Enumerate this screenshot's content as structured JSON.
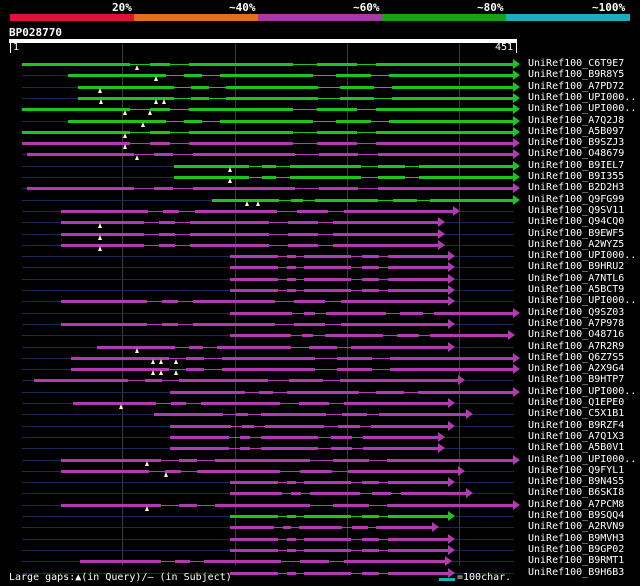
{
  "header": {
    "percent_labels": [
      "20%",
      "~40%",
      "~60%",
      "~80%",
      "~100%"
    ],
    "query_id": "BP028770",
    "query_start": "1",
    "query_end": "451"
  },
  "colors": {
    "scale": [
      "#e0103a",
      "#e0701e",
      "#a83aa8",
      "#18a018",
      "#18b0c0"
    ],
    "green": "#1ec41e",
    "purple": "#b03ab0",
    "background_line": "#1b2a55",
    "gap_marker": "#fff8c0"
  },
  "hits": [
    {
      "label": "UniRef100_C6T9E7",
      "start": 1,
      "end": 451,
      "color": "green",
      "gaps": [
        106
      ]
    },
    {
      "label": "UniRef100_B9R8Y5",
      "start": 43,
      "end": 451,
      "color": "green",
      "gaps": [
        124
      ]
    },
    {
      "label": "UniRef100_A7PD72",
      "start": 52,
      "end": 451,
      "color": "green",
      "gaps": [
        72
      ]
    },
    {
      "label": "UniRef100_UPI000..",
      "start": 52,
      "end": 451,
      "color": "green",
      "gaps": [
        73,
        124,
        131
      ]
    },
    {
      "label": "UniRef100_UPI000..",
      "start": 1,
      "end": 451,
      "color": "green",
      "gaps": [
        95,
        118
      ]
    },
    {
      "label": "UniRef100_A7Q2J8",
      "start": 43,
      "end": 451,
      "color": "green",
      "gaps": [
        112
      ]
    },
    {
      "label": "UniRef100_A5B097",
      "start": 1,
      "end": 451,
      "color": "green",
      "gaps": [
        95
      ]
    },
    {
      "label": "UniRef100_B9SZJ3",
      "start": 1,
      "end": 451,
      "color": "purple",
      "gaps": [
        95
      ]
    },
    {
      "label": "UniRef100_O48679",
      "start": 6,
      "end": 451,
      "color": "purple",
      "gaps": [
        106
      ]
    },
    {
      "label": "UniRef100_B9IEL7",
      "start": 140,
      "end": 451,
      "color": "green",
      "gaps": [
        191
      ]
    },
    {
      "label": "UniRef100_B9I355",
      "start": 140,
      "end": 451,
      "color": "green",
      "gaps": [
        191
      ]
    },
    {
      "label": "UniRef100_B2D2H3",
      "start": 6,
      "end": 451,
      "color": "purple",
      "gaps": []
    },
    {
      "label": "UniRef100_Q9FG99",
      "start": 175,
      "end": 451,
      "color": "green",
      "gaps": [
        207,
        217
      ]
    },
    {
      "label": "UniRef100_Q9SV11",
      "start": 37,
      "end": 396,
      "color": "purple",
      "gaps": []
    },
    {
      "label": "UniRef100_Q94CQ0",
      "start": 37,
      "end": 382,
      "color": "purple",
      "gaps": [
        72
      ]
    },
    {
      "label": "UniRef100_B9EWF5",
      "start": 37,
      "end": 382,
      "color": "purple",
      "gaps": [
        72
      ]
    },
    {
      "label": "UniRef100_A2WYZ5",
      "start": 37,
      "end": 382,
      "color": "purple",
      "gaps": [
        72
      ]
    },
    {
      "label": "UniRef100_UPI000..",
      "start": 191,
      "end": 392,
      "color": "purple",
      "gaps": []
    },
    {
      "label": "UniRef100_B9HRU2",
      "start": 191,
      "end": 392,
      "color": "purple",
      "gaps": []
    },
    {
      "label": "UniRef100_A7NTL6",
      "start": 191,
      "end": 392,
      "color": "purple",
      "gaps": []
    },
    {
      "label": "UniRef100_A5BCT9",
      "start": 191,
      "end": 392,
      "color": "purple",
      "gaps": []
    },
    {
      "label": "UniRef100_UPI000..",
      "start": 37,
      "end": 392,
      "color": "purple",
      "gaps": []
    },
    {
      "label": "UniRef100_Q9SZ03",
      "start": 191,
      "end": 451,
      "color": "purple",
      "gaps": []
    },
    {
      "label": "UniRef100_A7P978",
      "start": 37,
      "end": 392,
      "color": "purple",
      "gaps": []
    },
    {
      "label": "UniRef100_O48716",
      "start": 191,
      "end": 446,
      "color": "purple",
      "gaps": []
    },
    {
      "label": "UniRef100_A7R2R9",
      "start": 70,
      "end": 392,
      "color": "purple",
      "gaps": [
        106
      ]
    },
    {
      "label": "UniRef100_Q6Z7S5",
      "start": 46,
      "end": 451,
      "color": "purple",
      "gaps": [
        121,
        128,
        142
      ]
    },
    {
      "label": "UniRef100_A2X9G4",
      "start": 46,
      "end": 451,
      "color": "purple",
      "gaps": [
        121,
        128,
        142
      ]
    },
    {
      "label": "UniRef100_B9HTP7",
      "start": 12,
      "end": 401,
      "color": "purple",
      "gaps": []
    },
    {
      "label": "UniRef100_UPI000..",
      "start": 136,
      "end": 451,
      "color": "purple",
      "gaps": []
    },
    {
      "label": "UniRef100_Q1EPE0",
      "start": 48,
      "end": 392,
      "color": "purple",
      "gaps": [
        92
      ]
    },
    {
      "label": "UniRef100_C5X1B1",
      "start": 122,
      "end": 408,
      "color": "purple",
      "gaps": []
    },
    {
      "label": "UniRef100_B9RZF4",
      "start": 136,
      "end": 392,
      "color": "purple",
      "gaps": []
    },
    {
      "label": "UniRef100_A7Q1X3",
      "start": 136,
      "end": 382,
      "color": "purple",
      "gaps": []
    },
    {
      "label": "UniRef100_A5B0V1",
      "start": 136,
      "end": 382,
      "color": "purple",
      "gaps": []
    },
    {
      "label": "UniRef100_UPI000..",
      "start": 37,
      "end": 451,
      "color": "purple",
      "gaps": [
        115
      ]
    },
    {
      "label": "UniRef100_Q9FYL1",
      "start": 37,
      "end": 401,
      "color": "purple",
      "gaps": [
        133
      ]
    },
    {
      "label": "UniRef100_B9N4S5",
      "start": 191,
      "end": 392,
      "color": "purple",
      "gaps": []
    },
    {
      "label": "UniRef100_B6SKI8",
      "start": 191,
      "end": 408,
      "color": "purple",
      "gaps": []
    },
    {
      "label": "UniRef100_A7PCM8",
      "start": 37,
      "end": 451,
      "color": "purple",
      "gaps": [
        115
      ]
    },
    {
      "label": "UniRef100_B9SQQ4",
      "start": 191,
      "end": 392,
      "color": "green",
      "gaps": []
    },
    {
      "label": "UniRef100_A2RVN9",
      "start": 191,
      "end": 377,
      "color": "purple",
      "gaps": []
    },
    {
      "label": "UniRef100_B9MVH3",
      "start": 191,
      "end": 392,
      "color": "purple",
      "gaps": []
    },
    {
      "label": "UniRef100_B9GP02",
      "start": 191,
      "end": 392,
      "color": "purple",
      "gaps": []
    },
    {
      "label": "UniRef100_B9RMT1",
      "start": 54,
      "end": 389,
      "color": "purple",
      "gaps": []
    },
    {
      "label": "UniRef100_B9H6B3",
      "start": 191,
      "end": 392,
      "color": "purple",
      "gaps": []
    }
  ],
  "legend": {
    "text": "Large gaps:▲(in Query)/– (in Subject)",
    "scale_text": "=100char."
  }
}
